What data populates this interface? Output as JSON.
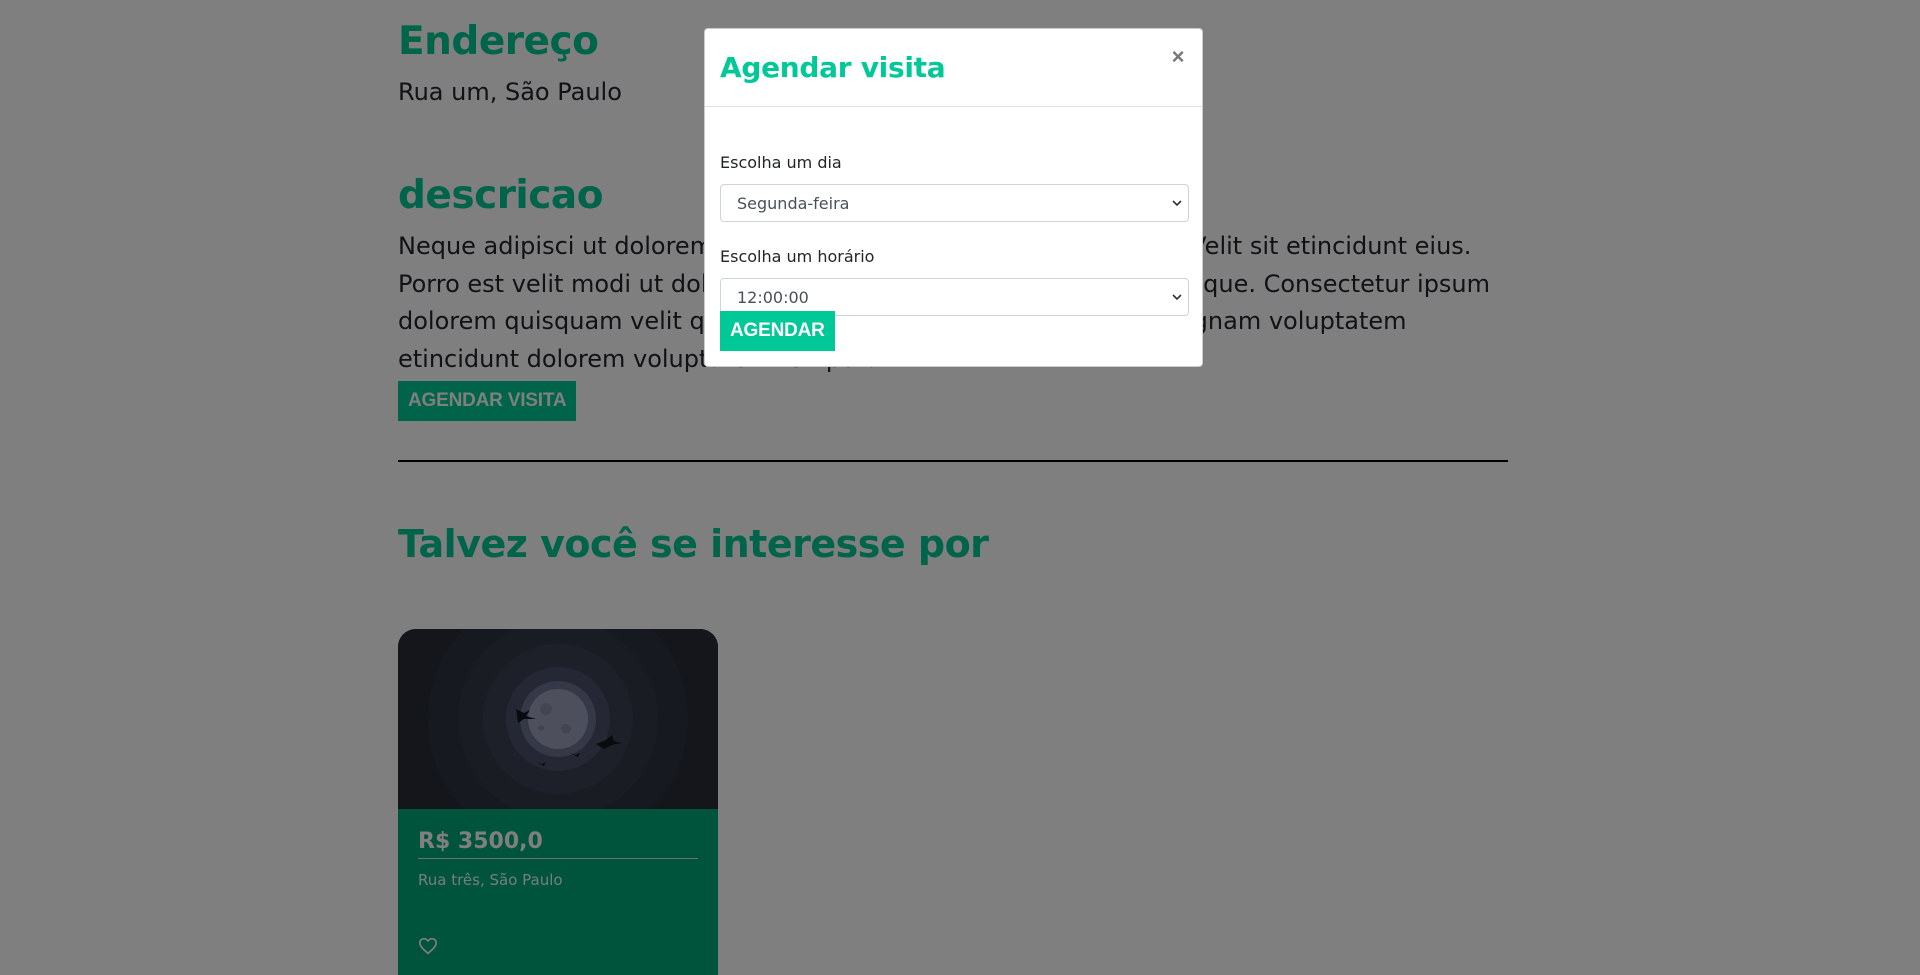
{
  "address": {
    "title": "Endereço",
    "text": "Rua um, São Paulo"
  },
  "description": {
    "title": "descricao",
    "text": "Neque adipisci ut dolorem eius amet dolore quaerat dolore modi. Velit sit etincidunt eius. Porro est velit modi ut dolorem. Voluptatem sit ipsum quisquam neque. Consectetur ipsum dolorem quisquam velit quiquia dolore ipsum eius quaerat. Sit magnam voluptatem etincidunt dolorem voluptatem tempora."
  },
  "visit_button_label": "AGENDAR VISITA",
  "suggestions": {
    "title": "Talvez você se interesse por",
    "cards": [
      {
        "price": "R$ 3500,0",
        "address": "Rua três, São Paulo",
        "fav_icon": "heart-icon"
      }
    ]
  },
  "modal": {
    "title": "Agendar visita",
    "close_label": "×",
    "day_label": "Escolha um dia",
    "day_selected": "Segunda-feira",
    "time_label": "Escolha um horário",
    "time_selected": "12:00:00",
    "submit_label": "AGENDAR"
  },
  "colors": {
    "accent": "#00c896",
    "overlay": "rgba(0,0,0,0.5)",
    "card_body": "#00a878"
  }
}
